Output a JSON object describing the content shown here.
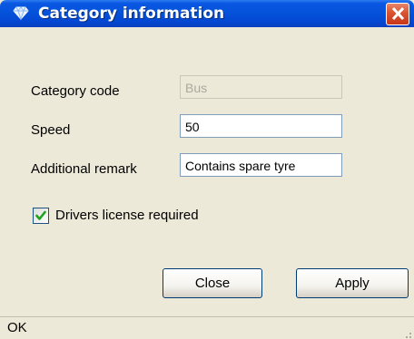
{
  "window": {
    "title": "Category information",
    "title_icon": "diamond-icon",
    "close_icon": "close-icon"
  },
  "form": {
    "category_code": {
      "label": "Category code",
      "value": "Bus",
      "enabled": false
    },
    "speed": {
      "label": "Speed",
      "value": "50"
    },
    "remark": {
      "label": "Additional remark",
      "value": "Contains spare tyre"
    },
    "license": {
      "label": "Drivers license required",
      "checked": true
    }
  },
  "buttons": {
    "close": "Close",
    "apply": "Apply"
  },
  "status": {
    "text": "OK"
  },
  "colors": {
    "titlebar": "#0552DB",
    "close_button": "#D9532F",
    "window_bg": "#ECE9D8",
    "checkmark": "#21A121"
  }
}
